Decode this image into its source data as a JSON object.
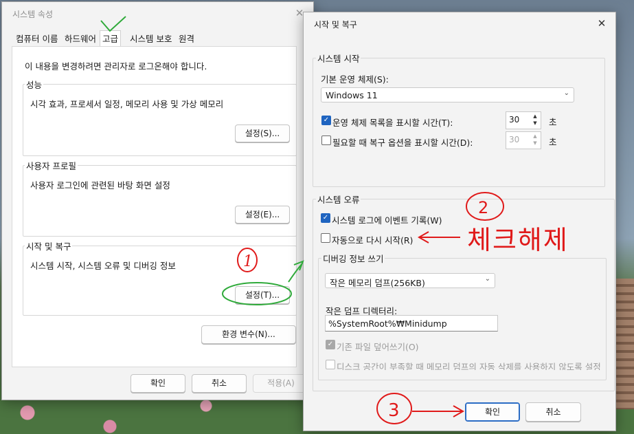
{
  "system_properties": {
    "title": "시스템 속성",
    "close_glyph": "✕",
    "tabs": [
      "컴퓨터 이름",
      "하드웨어",
      "고급",
      "시스템 보호",
      "원격"
    ],
    "admin_notice": "이 내용을 변경하려면 관리자로 로그온해야 합니다.",
    "performance": {
      "label": "성능",
      "description": "시각 효과, 프로세서 일정, 메모리 사용 및 가상 메모리",
      "button": "설정(S)..."
    },
    "user_profiles": {
      "label": "사용자 프로필",
      "description": "사용자 로그인에 관련된 바탕 화면 설정",
      "button": "설정(E)..."
    },
    "startup_recovery": {
      "label": "시작 및 복구",
      "description": "시스템 시작, 시스템 오류 및 디버깅 정보",
      "button": "설정(T)..."
    },
    "env_button": "환경 변수(N)...",
    "ok": "확인",
    "cancel": "취소",
    "apply": "적용(A)"
  },
  "startup_dialog": {
    "title": "시작 및 복구",
    "close_glyph": "✕",
    "system_startup": {
      "label": "시스템 시작",
      "default_os_label": "기본 운영 체제(S):",
      "default_os_value": "Windows 11",
      "show_os_list_label": "운영 체제 목록을 표시할 시간(T):",
      "show_os_list_checked": true,
      "show_os_list_value": "30",
      "show_recovery_label": "필요할 때 복구 옵션을 표시할 시간(D):",
      "show_recovery_checked": false,
      "show_recovery_value": "30",
      "unit": "초"
    },
    "system_failure": {
      "label": "시스템 오류",
      "write_event_label": "시스템 로그에 이벤트 기록(W)",
      "write_event_checked": true,
      "auto_restart_label": "자동으로 다시 시작(R)",
      "auto_restart_checked": false,
      "debug_group_label": "디버깅 정보 쓰기",
      "debug_type_value": "작은 메모리 덤프(256KB)",
      "dump_dir_label": "작은 덤프 디렉터리:",
      "dump_dir_value": "%SystemRoot%₩Minidump",
      "overwrite_label": "기존 파일 덮어쓰기(O)",
      "overwrite_checked": true,
      "disable_auto_delete_label": "디스크 공간이 부족할 때 메모리 덤프의 자동 삭제를 사용하지 않도록 설정",
      "disable_auto_delete_checked": false
    },
    "ok": "확인",
    "cancel": "취소"
  },
  "annotations": {
    "mark_1": "1",
    "mark_2": "2",
    "mark_3": "3",
    "uncheck_note": "체크해제",
    "check_mark_color": "#2faa3a",
    "annotation_color": "#e01a1a"
  }
}
